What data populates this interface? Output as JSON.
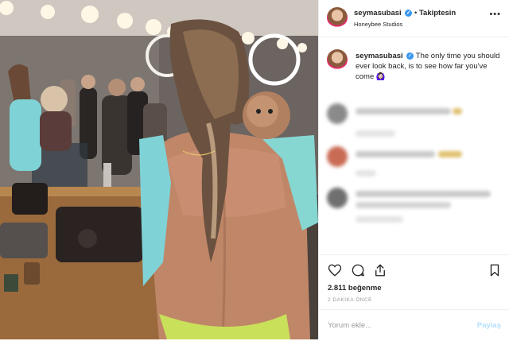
{
  "post": {
    "username": "seymasubasi",
    "verified_icon": "verified-badge-icon",
    "separator": "•",
    "follow_status": "Takiptesin",
    "location": "Honeybee Studios",
    "more_icon": "more-options-icon"
  },
  "caption": {
    "username": "seymasubasi",
    "text": "The only time you should ever look back, is to see how far you've come 🙆🏻‍♀️"
  },
  "comments": [
    {
      "blurred": true
    },
    {
      "blurred": true
    },
    {
      "blurred": true
    }
  ],
  "actions": {
    "like_icon": "heart-icon",
    "comment_icon": "comment-icon",
    "share_icon": "share-icon",
    "save_icon": "bookmark-icon",
    "likes": "2.811 beğenme",
    "time": "2 DAKİKA ÖNCE",
    "comment_placeholder": "Yorum ekle...",
    "share_label": "Paylaş"
  },
  "colors": {
    "accent_blue": "#3897f0",
    "disabled_blue": "#b2dffc",
    "text": "#262626",
    "muted": "#999999",
    "border": "#efefef"
  }
}
